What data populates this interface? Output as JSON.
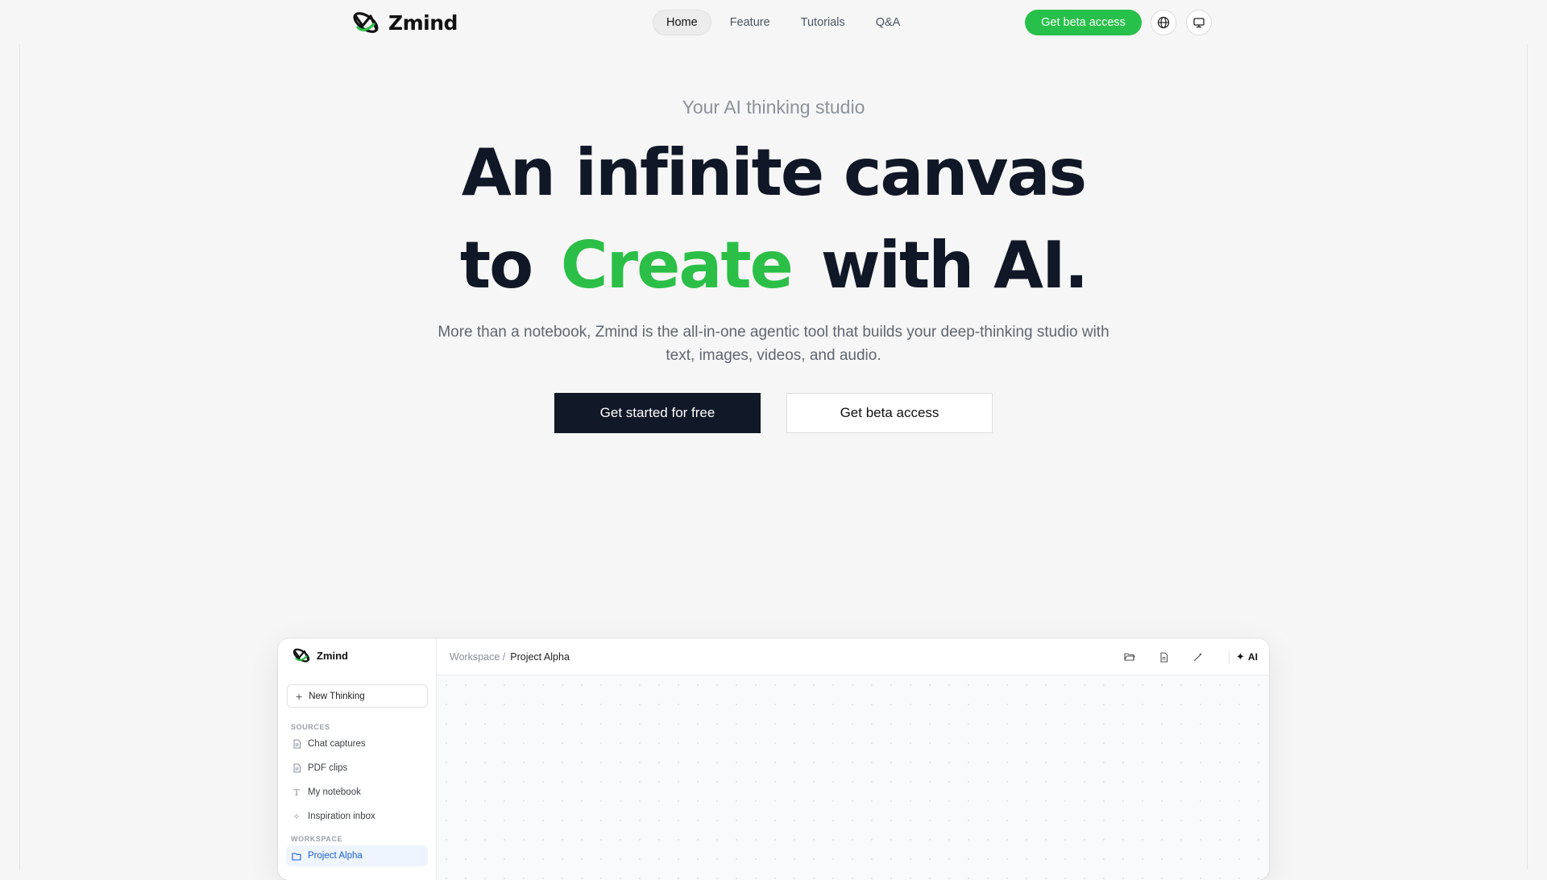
{
  "brand": {
    "name": "Zmind",
    "accent": "#2bbf47"
  },
  "nav": {
    "links": [
      {
        "label": "Home",
        "active": true
      },
      {
        "label": "Feature"
      },
      {
        "label": "Tutorials"
      },
      {
        "label": "Q&A"
      }
    ],
    "beta_label": "Get beta access",
    "icons": [
      "globe-icon",
      "monitor-icon"
    ]
  },
  "hero": {
    "eyebrow": "Your AI thinking studio",
    "line1": "An infinite canvas",
    "line2_pre": "to",
    "line2_accent": "Create",
    "line2_post": "with AI.",
    "subtext": "More than a notebook, Zmind is the all-in-one agentic tool that builds your deep-thinking studio with text, images, videos, and audio.",
    "cta_primary": "Get started for free",
    "cta_secondary": "Get beta access"
  },
  "app": {
    "logo_text": "Zmind",
    "new_thinking": "New Thinking",
    "sources_label": "SOURCES",
    "sources": [
      {
        "label": "Chat captures",
        "icon": "document-icon"
      },
      {
        "label": "PDF clips",
        "icon": "document-icon"
      },
      {
        "label": "My notebook",
        "icon": "text-icon"
      },
      {
        "label": "Inspiration inbox",
        "icon": "sparkle-icon"
      }
    ],
    "workspace_label": "WORKSPACE",
    "workspace_items": [
      {
        "label": "Project Alpha",
        "icon": "folder-icon",
        "selected": true
      }
    ],
    "breadcrumb": {
      "parent": "Workspace /",
      "current": "Project Alpha"
    },
    "toolbar": {
      "ai_label": "AI",
      "icons": [
        "folder-open-icon",
        "document-icon",
        "magic-wand-icon",
        "sparkle-icon"
      ]
    }
  }
}
